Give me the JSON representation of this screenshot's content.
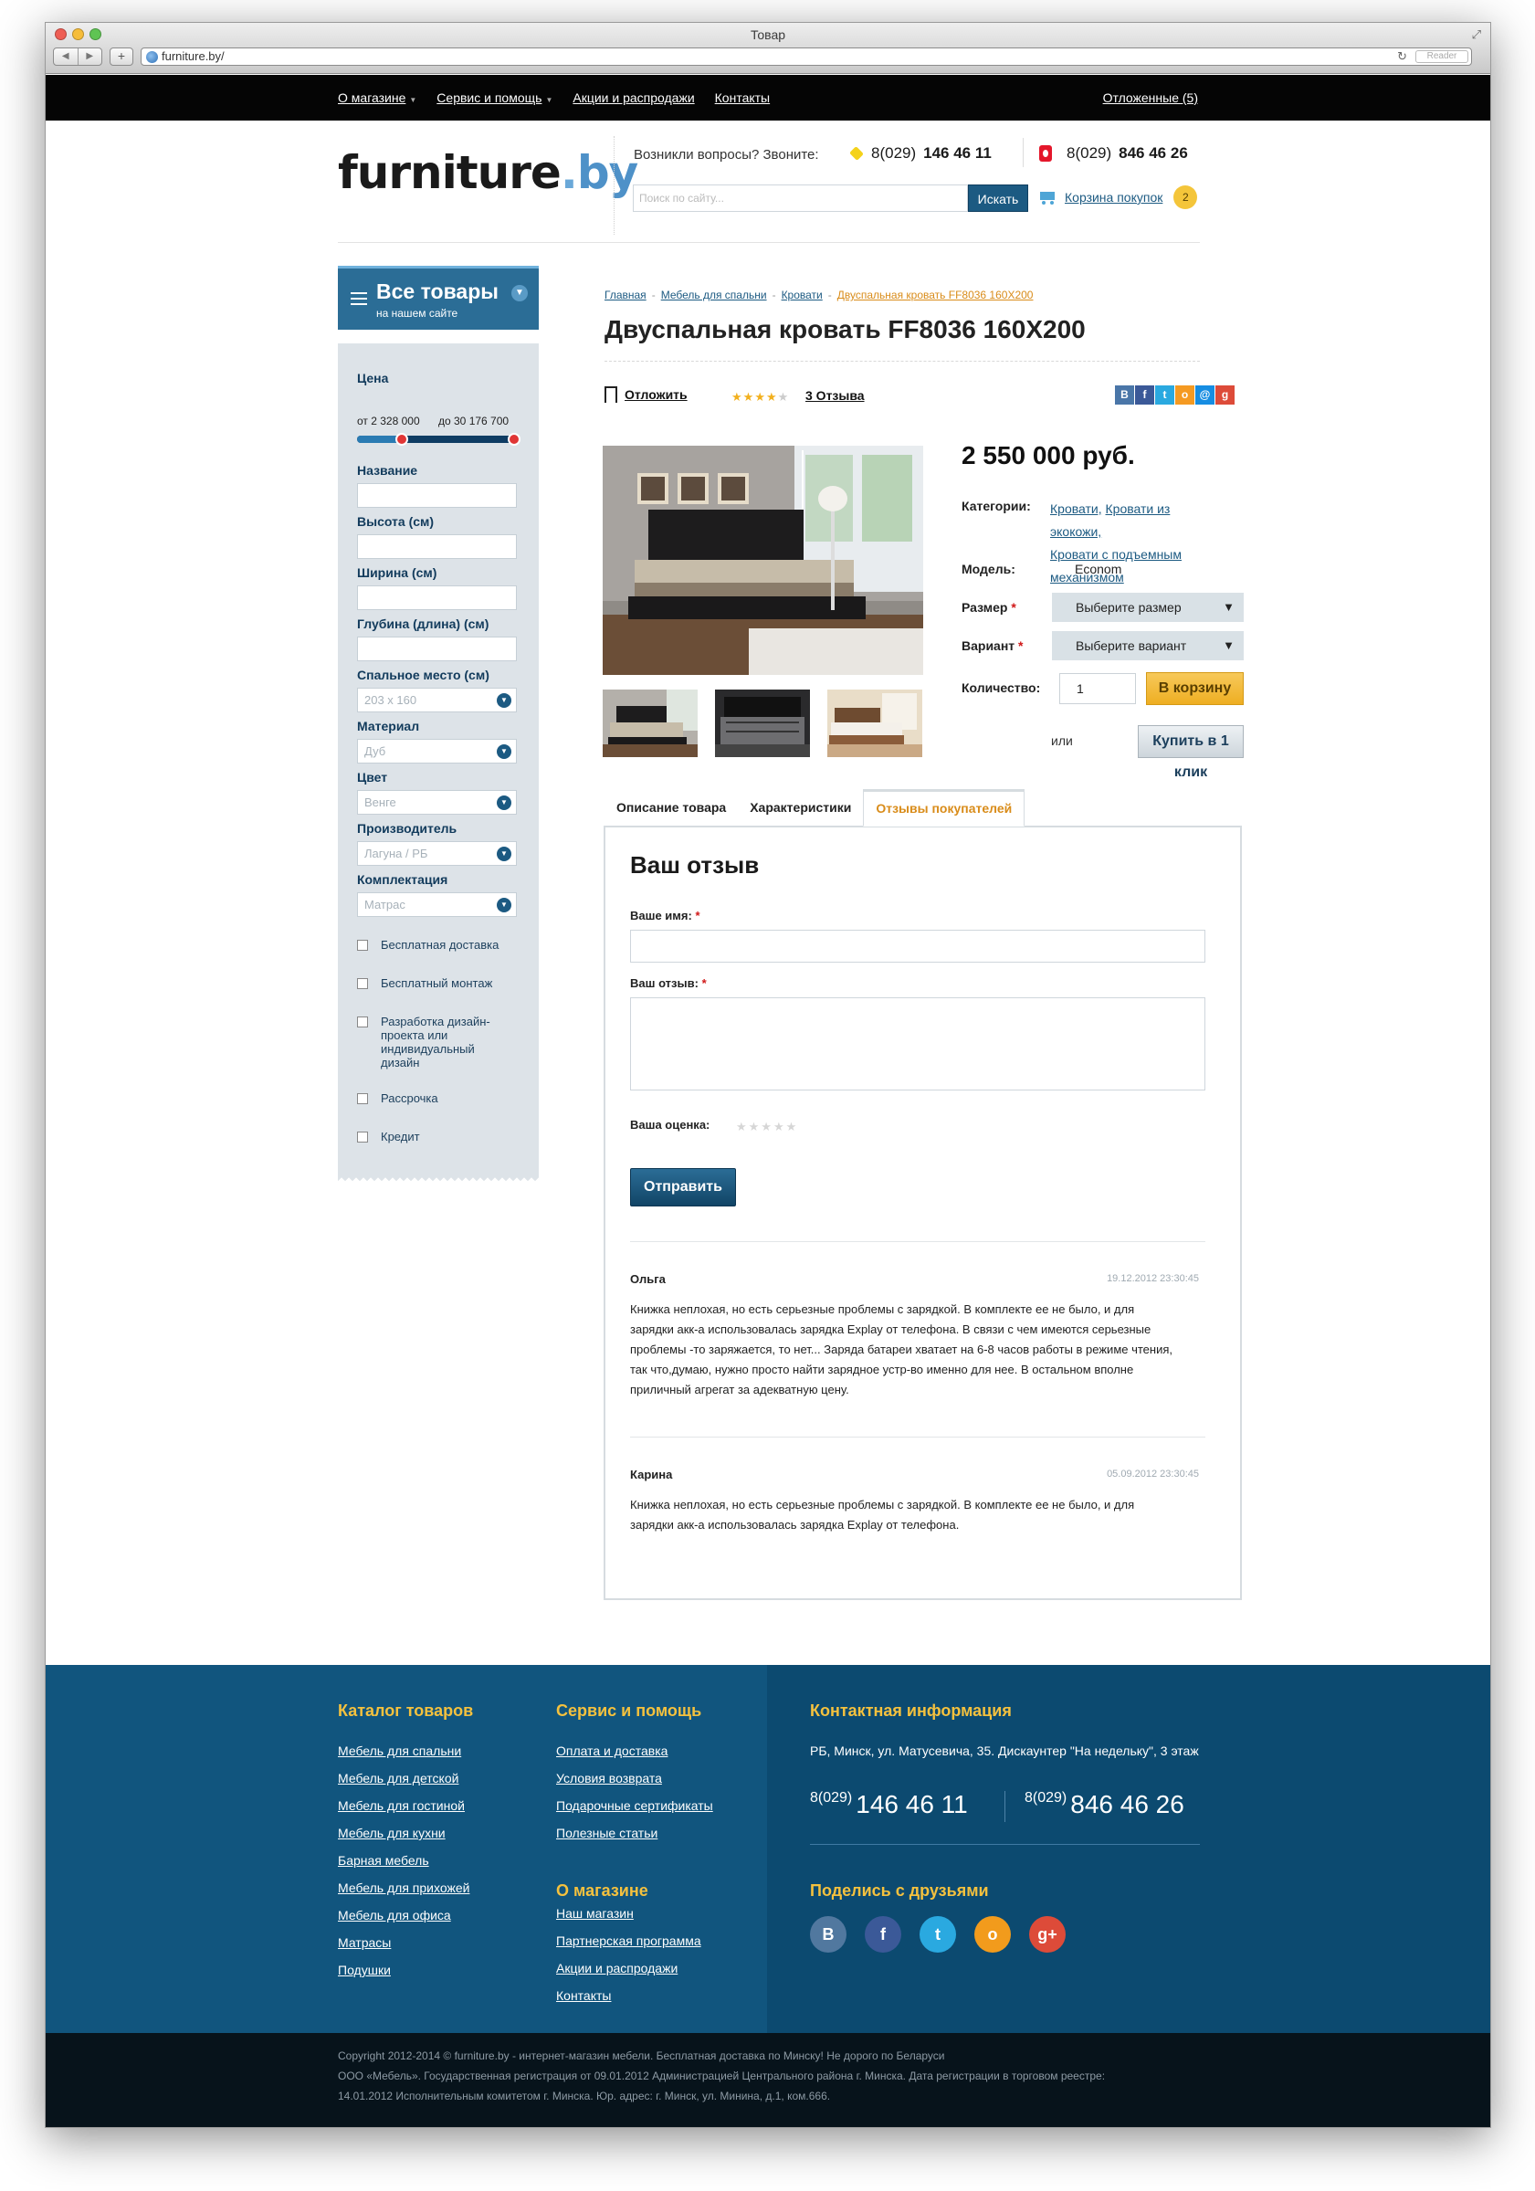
{
  "browser": {
    "title": "Товар",
    "url": "furniture.by/",
    "reader_label": "Reader"
  },
  "topnav": {
    "items": [
      "О магазине",
      "Сервис и помощь",
      "Акции и распродажи",
      "Контакты"
    ],
    "postponed": "Отложенные (5)"
  },
  "header": {
    "logo_main": "furniture",
    "logo_dot": ".",
    "logo_by": "by",
    "questions": "Возникли вопросы? Звоните:",
    "phone1_prefix": "8(029)",
    "phone1_number": "146 46 11",
    "phone2_prefix": "8(029)",
    "phone2_number": "846 46 26",
    "search_placeholder": "Поиск по сайту...",
    "search_button": "Искать",
    "cart_label": "Корзина покупок",
    "cart_count": "2"
  },
  "sidebar": {
    "title": "Все товары",
    "subtitle": "на нашем сайте",
    "price_label": "Цена",
    "price_from": "от 2 328 000",
    "price_to": "до 30 176 700",
    "price_range_from_fraction": 0.28,
    "price_range_to_fraction": 0.98,
    "name_label": "Название",
    "height_label": "Высота (см)",
    "width_label": "Ширина (см)",
    "depth_label": "Глубина (длина) (см)",
    "sleep_label": "Спальное место (см)",
    "sleep_value": "203 x 160",
    "material_label": "Материал",
    "material_value": "Дуб",
    "color_label": "Цвет",
    "color_value": "Венге",
    "maker_label": "Производитель",
    "maker_value": "Лагуна / РБ",
    "kit_label": "Комплектация",
    "kit_value": "Матрас",
    "checks": [
      "Бесплатная доставка",
      "Бесплатный монтаж",
      "Разработка дизайн-проекта или индивидуальный дизайн",
      "Рассрочка",
      "Кредит"
    ]
  },
  "breadcrumb": {
    "items": [
      "Главная",
      "Мебель для спальни",
      "Кровати"
    ],
    "current": "Двуспальная кровать FF8036 160X200"
  },
  "product": {
    "title": "Двуспальная кровать FF8036 160X200",
    "postpone": "Отложить",
    "rating": 4,
    "reviews_link": "3 Отзыва",
    "price": "2 550 000 руб.",
    "categories_label": "Категории:",
    "categories": [
      "Кровати,",
      "Кровати из экокожи,",
      "Кровати с подъемным механизмом"
    ],
    "model_label": "Модель:",
    "model_value": "Econom",
    "size_label": "Размер",
    "size_value": "Выберите размер",
    "variant_label": "Вариант",
    "variant_value": "Выберите вариант",
    "qty_label": "Количество:",
    "qty_value": "1",
    "cart_button": "В корзину",
    "or": "или",
    "oneclick_button": "Купить в 1 клик"
  },
  "tabs": [
    "Описание товара",
    "Характеристики",
    "Отзывы покупателей"
  ],
  "review_form": {
    "title": "Ваш отзыв",
    "name_label": "Ваше имя:",
    "text_label": "Ваш отзыв:",
    "rating_label": "Ваша оценка:",
    "submit": "Отправить",
    "required_mark": "*"
  },
  "reviews": [
    {
      "author": "Ольга",
      "date": "19.12.2012 23:30:45",
      "lines": [
        "Книжка неплохая, но есть серьезные проблемы с зарядкой. В комплекте ее не было, и для",
        "зарядки акк-а использовалась зарядка Explay от телефона. В связи с чем имеются серьезные",
        "проблемы -то заряжается, то нет... Заряда батареи хватает на 6-8 часов работы в режиме чтения,",
        "так что,думаю, нужно просто найти зарядное устр-во именно для нее. В остальном вполне",
        "приличный агрегат за адекватную цену."
      ]
    },
    {
      "author": "Карина",
      "date": "05.09.2012 23:30:45",
      "lines": [
        "Книжка неплохая, но есть серьезные проблемы с зарядкой. В комплекте ее не было, и для",
        "зарядки акк-а использовалась зарядка Explay от телефона."
      ]
    }
  ],
  "footer": {
    "catalog_title": "Каталог товаров",
    "catalog_links": [
      "Мебель для спальни",
      "Мебель для детской",
      "Мебель для гостиной",
      "Мебель для кухни",
      "Барная мебель",
      "Мебель для прихожей",
      "Мебель для офиса",
      "Матрасы",
      "Подушки"
    ],
    "service_title": "Сервис и помощь",
    "service_links": [
      "Оплата и доставка",
      "Условия возврата",
      "Подарочные сертификаты",
      "Полезные статьи"
    ],
    "about_title": "О магазине",
    "about_links": [
      "Наш магазин",
      "Партнерская программа",
      "Акции и распродажи",
      "Контакты"
    ],
    "contact_title": "Контактная информация",
    "address": "РБ, Минск, ул. Матусевича, 35. Дискаунтер \"На недельку\", 3 этаж",
    "phone1_prefix": "8(029)",
    "phone1_number": "146 46 11",
    "phone2_prefix": "8(029)",
    "phone2_number": "846 46 26",
    "share_title": "Поделись с друзьями"
  },
  "copyright": {
    "line1": "Copyright 2012-2014 © furniture.by - интернет-магазин мебели. Бесплатная доставка по Минску! Не дорого по Беларуси",
    "line2": "ООО «Мебель». Государственная регистрация от 09.01.2012 Администрацией Центрального района г. Минска. Дата регистрации в торговом реестре:",
    "line3": "14.01.2012 Исполнительным комитетом г. Минска. Юр. адрес: г. Минск, ул. Минина, д.1, ком.666."
  },
  "colors": {
    "brand_blue": "#1c5a82",
    "accent_orange": "#d98c1a",
    "footer_bg": "#11557e",
    "footer_heading": "#f4c13e"
  }
}
